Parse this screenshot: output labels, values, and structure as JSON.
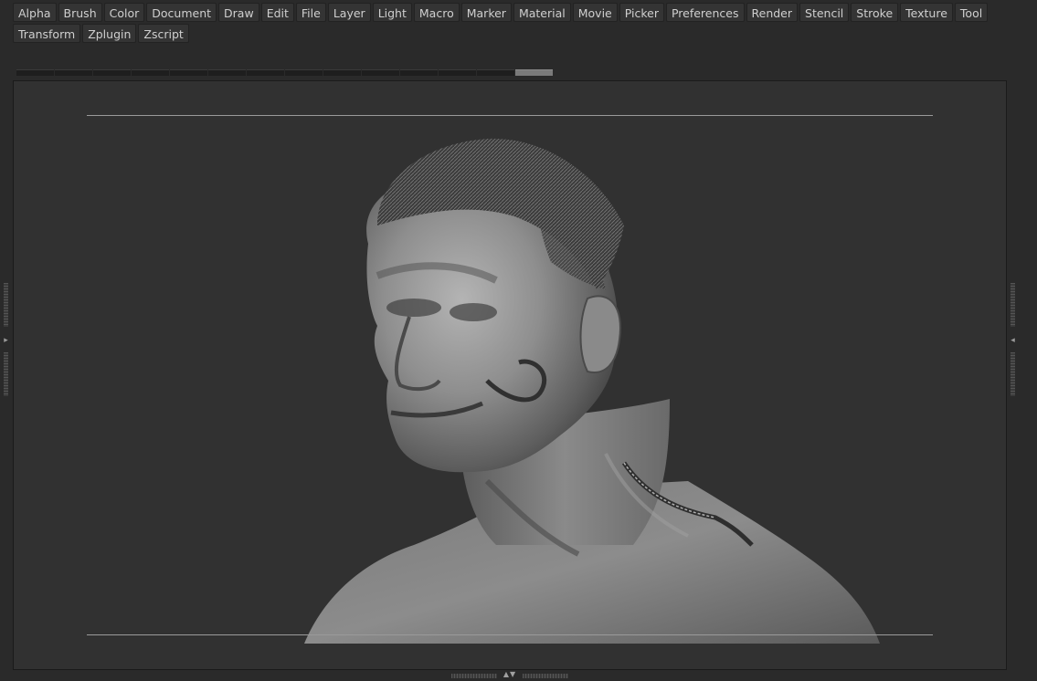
{
  "menubar": {
    "items": [
      {
        "label": "Alpha"
      },
      {
        "label": "Brush"
      },
      {
        "label": "Color"
      },
      {
        "label": "Document"
      },
      {
        "label": "Draw"
      },
      {
        "label": "Edit"
      },
      {
        "label": "File"
      },
      {
        "label": "Layer"
      },
      {
        "label": "Light"
      },
      {
        "label": "Macro"
      },
      {
        "label": "Marker"
      },
      {
        "label": "Material"
      },
      {
        "label": "Movie"
      },
      {
        "label": "Picker"
      },
      {
        "label": "Preferences"
      },
      {
        "label": "Render"
      },
      {
        "label": "Stencil"
      },
      {
        "label": "Stroke"
      },
      {
        "label": "Texture"
      },
      {
        "label": "Tool"
      },
      {
        "label": "Transform"
      },
      {
        "label": "Zplugin"
      },
      {
        "label": "Zscript"
      }
    ]
  },
  "tabstrip": {
    "segment_count": 14,
    "active_index": 13
  },
  "icons": {
    "left_expand": "triangle-right-icon",
    "right_expand": "triangle-left-icon",
    "bottom_toggle": "triangle-up-down-icon"
  },
  "colors": {
    "background": "#2a2a2a",
    "canvas": "#313131",
    "menu_button": "#343434",
    "guide_line": "#9a9a9a",
    "sculpt_clay": "#8c8c8c"
  }
}
